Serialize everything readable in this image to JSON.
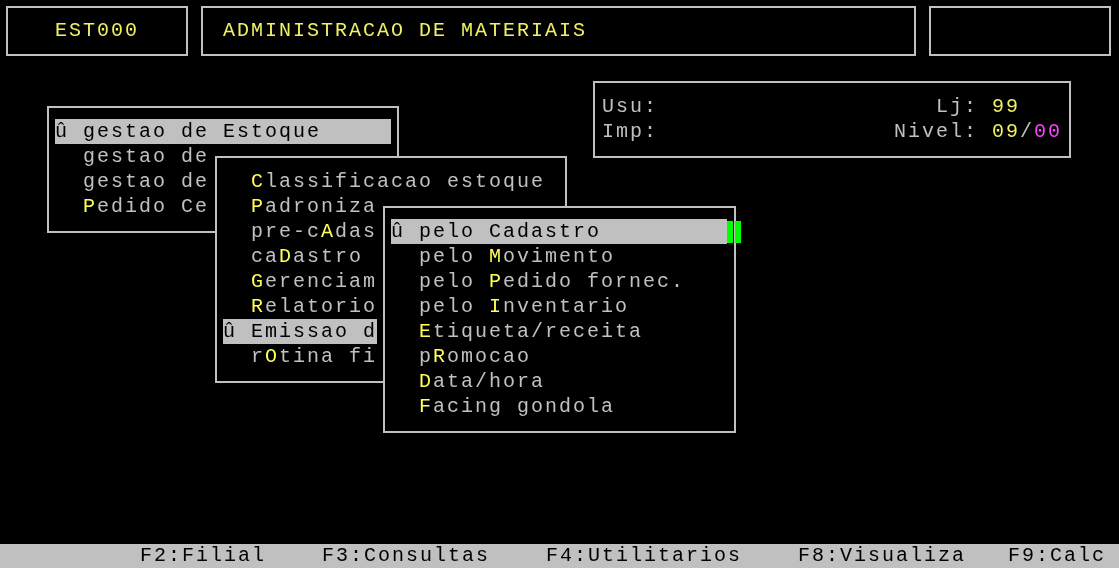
{
  "header": {
    "program_code": "EST000",
    "title": "ADMINISTRACAO DE MATERIAIS"
  },
  "info": {
    "user_label": "Usu:",
    "printer_label": "Imp:",
    "store_label": "Lj:",
    "store_value": "99",
    "level_label": "Nivel:",
    "level_value": "09",
    "level_separator": "/",
    "level_max": "00"
  },
  "menus": [
    {
      "cursor": false,
      "items": [
        {
          "pre": "û gestao de ",
          "key": "E",
          "post": "stoque",
          "selected": true
        },
        {
          "pre": "gestao de",
          "selected": false
        },
        {
          "pre": "gestao de",
          "selected": false
        },
        {
          "key": "P",
          "post": "edido Ce",
          "selected": false
        }
      ]
    },
    {
      "cursor": false,
      "items": [
        {
          "key": "C",
          "post": "lassificacao estoque",
          "selected": false
        },
        {
          "key": "P",
          "post": "adroniza",
          "selected": false
        },
        {
          "pre": "pre-c",
          "key": "A",
          "post": "das",
          "selected": false
        },
        {
          "pre": "ca",
          "key": "D",
          "post": "astro",
          "selected": false
        },
        {
          "key": "G",
          "post": "erenciam",
          "selected": false
        },
        {
          "key": "R",
          "post": "elatorio",
          "selected": false
        },
        {
          "pre": "û ",
          "key": "E",
          "post": "missao d",
          "selected": true
        },
        {
          "pre": "r",
          "key": "O",
          "post": "tina fi",
          "selected": false
        }
      ]
    },
    {
      "cursor": true,
      "items": [
        {
          "pre": "û pelo ",
          "key": "C",
          "post": "adastro",
          "selected": true
        },
        {
          "pre": "pelo ",
          "key": "M",
          "post": "ovimento",
          "selected": false
        },
        {
          "pre": "pelo ",
          "key": "P",
          "post": "edido fornec.",
          "selected": false
        },
        {
          "pre": "pelo ",
          "key": "I",
          "post": "nventario",
          "selected": false
        },
        {
          "key": "E",
          "post": "tiqueta/receita",
          "selected": false
        },
        {
          "pre": "p",
          "key": "R",
          "post": "omocao",
          "selected": false
        },
        {
          "key": "D",
          "post": "ata/hora",
          "selected": false
        },
        {
          "key": "F",
          "post": "acing gondola",
          "selected": false
        }
      ]
    }
  ],
  "function_keys": [
    "F2:Filial",
    "F3:Consultas",
    "F4:Utilitarios",
    "F8:Visualiza",
    "F9:Calc"
  ]
}
